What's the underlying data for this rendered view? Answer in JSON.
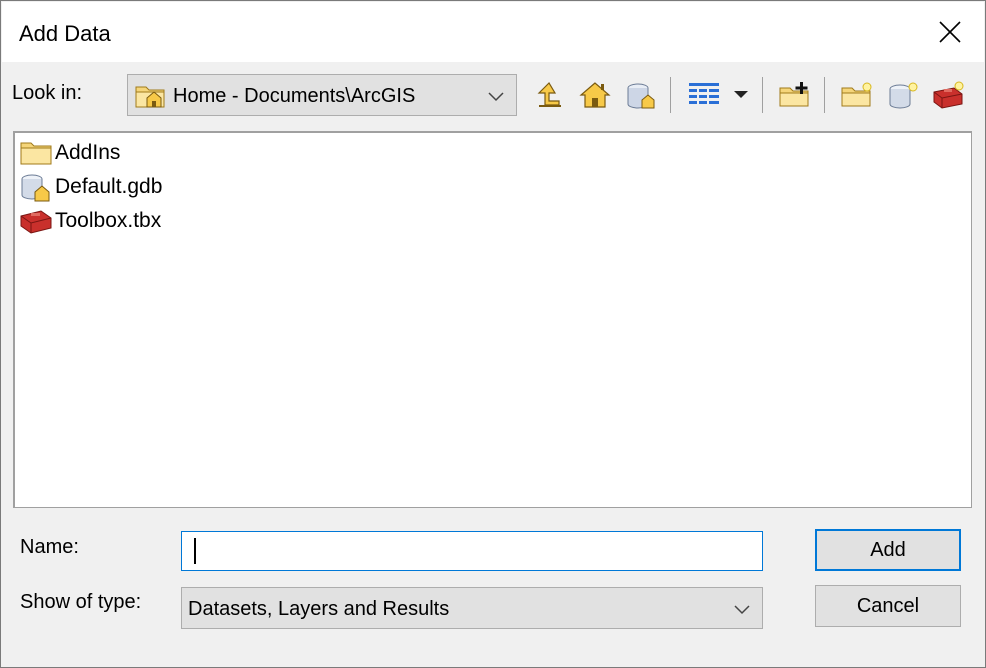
{
  "dialog": {
    "title": "Add Data"
  },
  "look_in": {
    "label": "Look in:",
    "value": "Home - Documents\\ArcGIS",
    "icon": "home-folder-icon"
  },
  "toolbar": {
    "buttons": [
      {
        "name": "up-one-level-icon"
      },
      {
        "name": "home-icon"
      },
      {
        "name": "connect-database-icon"
      },
      {
        "name": "list-view-icon"
      },
      {
        "name": "view-dropdown-icon"
      },
      {
        "name": "connect-folder-icon"
      },
      {
        "name": "new-folder-icon"
      },
      {
        "name": "new-geodatabase-icon"
      },
      {
        "name": "new-toolbox-icon"
      }
    ]
  },
  "files": [
    {
      "label": "AddIns",
      "icon": "folder-icon"
    },
    {
      "label": "Default.gdb",
      "icon": "home-geodatabase-icon"
    },
    {
      "label": "Toolbox.tbx",
      "icon": "toolbox-icon"
    }
  ],
  "name_field": {
    "label": "Name:",
    "value": ""
  },
  "type_field": {
    "label": "Show of type:",
    "value": "Datasets, Layers and Results"
  },
  "buttons": {
    "add": "Add",
    "cancel": "Cancel"
  },
  "colors": {
    "accent": "#0078d7",
    "button_face": "#e1e1e1",
    "window_bg": "#f0f0f0"
  }
}
